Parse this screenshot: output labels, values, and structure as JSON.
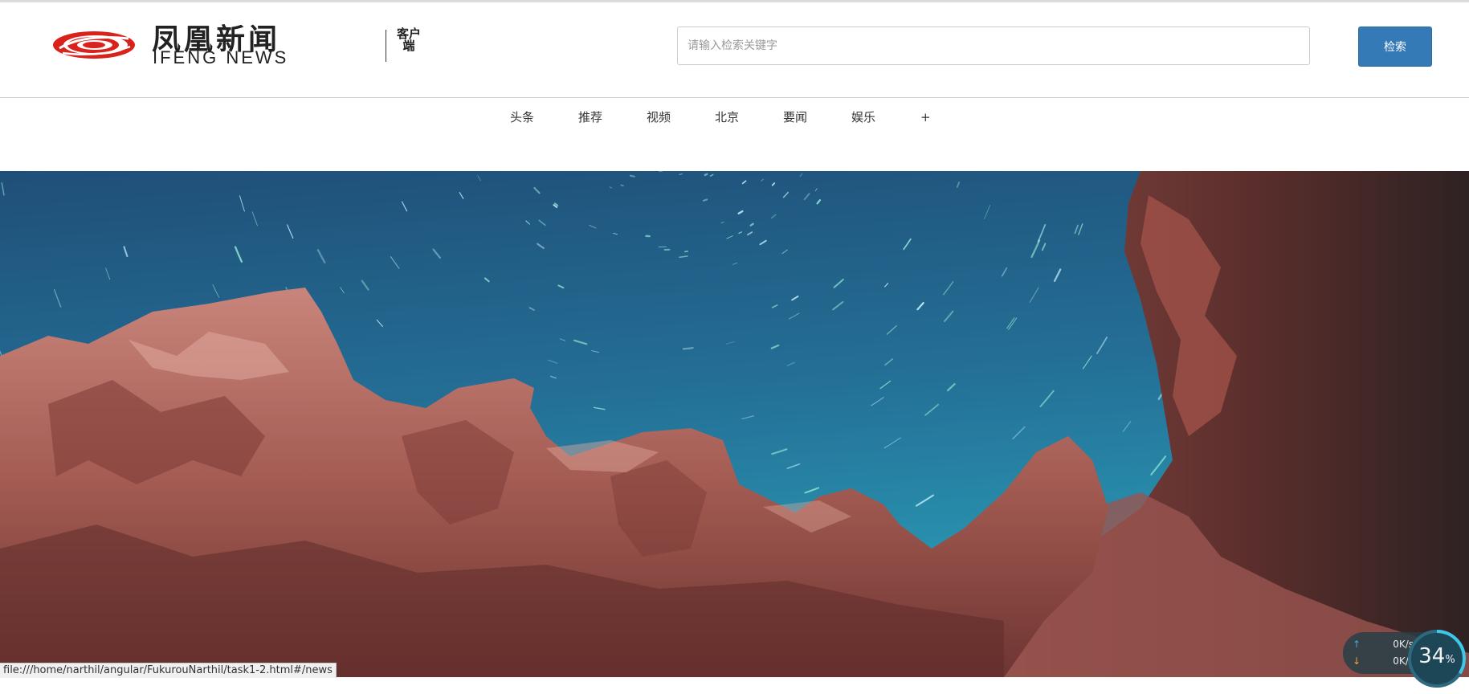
{
  "header": {
    "logo": {
      "brand_cn": "凤凰新闻",
      "brand_en": "IFENG NEWS",
      "client_label": "客户端"
    },
    "search": {
      "placeholder": "请输入检索关键字",
      "button_label": "检索"
    }
  },
  "nav": {
    "items": [
      {
        "label": "头条"
      },
      {
        "label": "推荐"
      },
      {
        "label": "视频"
      },
      {
        "label": "北京"
      },
      {
        "label": "要闻"
      },
      {
        "label": "娱乐"
      },
      {
        "label": "+"
      }
    ]
  },
  "hero": {
    "image": "star-trails-over-red-rock-cliffs"
  },
  "status_bar": {
    "url": "file:///home/narthil/angular/FukurouNarthil/task1-2.html#/news"
  },
  "network_monitor": {
    "upload": "0K/s",
    "download": "0K/s",
    "usage_value": "34",
    "usage_unit": "%",
    "usage_fraction": 0.34
  },
  "colors": {
    "accent": "#337ab7",
    "logo_red": "#d9221c",
    "sky_deep": "#1f4f78",
    "sky_light": "#2a9fb8",
    "rock": "#b86a60"
  }
}
